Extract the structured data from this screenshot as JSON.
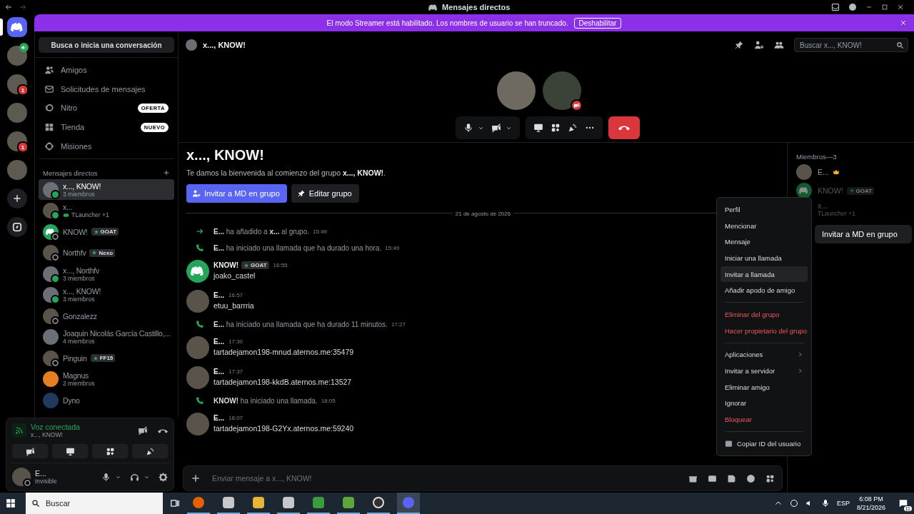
{
  "window": {
    "title": "Mensajes directos"
  },
  "banner": {
    "text": "El modo Streamer está habilitado. Los nombres de usuario se han truncado.",
    "button": "Deshabilitar"
  },
  "servers": [
    {
      "kind": "home",
      "selected": true
    },
    {
      "kind": "voice",
      "selected": false
    },
    {
      "kind": "photo",
      "badge": "1",
      "selected": false
    },
    {
      "kind": "photo",
      "selected": false
    },
    {
      "kind": "photo",
      "badge": "1",
      "selected": false
    },
    {
      "kind": "photo",
      "selected": false
    },
    {
      "kind": "add",
      "selected": false
    },
    {
      "kind": "discover",
      "selected": false
    }
  ],
  "sidebar": {
    "search": "Busca o inicia una conversación",
    "nav": [
      {
        "label": "Amigos"
      },
      {
        "label": "Solicitudes de mensajes"
      },
      {
        "label": "Nitro",
        "badge": "OFERTA"
      },
      {
        "label": "Tienda",
        "badge": "NUEVO"
      },
      {
        "label": "Misiones"
      }
    ],
    "dm_header": "Mensajes directos",
    "dms": [
      {
        "name": "x..., KNOW!",
        "subtitle": "3 miembros",
        "kind": "group",
        "online": true,
        "selected": true
      },
      {
        "name": "x...",
        "activity": "TLauncher +1",
        "kind": "user",
        "online": true,
        "selected": false
      },
      {
        "name": "KNOW!",
        "badge": "GOAT",
        "kind": "bot",
        "online": false,
        "selected": false
      },
      {
        "name": "Northfv",
        "badge": "Nexo",
        "kind": "user",
        "online": false,
        "selected": false
      },
      {
        "name": "x..., Northfv",
        "subtitle": "3 miembros",
        "kind": "group",
        "online": true,
        "selected": false
      },
      {
        "name": "x..., KNOW!",
        "subtitle": "3 miembros",
        "kind": "group",
        "online": true,
        "selected": false
      },
      {
        "name": "Gonzalezz",
        "kind": "user",
        "online": false,
        "selected": false
      },
      {
        "name": "Joaquin Nicolás García Castillo,...",
        "subtitle": "4 miembros",
        "kind": "group",
        "selected": false
      },
      {
        "name": "Pinguin",
        "badge": "FF15",
        "kind": "user",
        "online": false,
        "selected": false
      },
      {
        "name": "Magnus",
        "subtitle": "2 miembros",
        "kind": "orange_group",
        "selected": false
      },
      {
        "name": "Dyno",
        "kind": "app",
        "selected": false
      }
    ]
  },
  "voice_panel": {
    "status": "Voz conectada",
    "channel": "x..., KNOW!"
  },
  "user_panel": {
    "name": "E...",
    "status": "Invisible"
  },
  "chat": {
    "header": "x..., KNOW!",
    "search_placeholder": "Buscar x..., KNOW!",
    "call": [
      {
        "muted": false
      },
      {
        "muted": true
      }
    ],
    "title": "x..., KNOW!",
    "welcome": "Te damos la bienvenida al comienzo del grupo **x..., KNOW!**.",
    "buttons": [
      {
        "label": "Invitar a MD en grupo",
        "kind": "primary"
      },
      {
        "label": "Editar grupo",
        "kind": "secondary"
      }
    ],
    "date": "21 de agosto de 2026",
    "messages": [
      {
        "kind": "join",
        "text": "**E...** ha añadido a **x...** al grupo.",
        "time": "15:49"
      },
      {
        "kind": "call",
        "text": "**E...** ha iniciado una llamada que ha durado una hora.",
        "time": "15:49"
      },
      {
        "kind": "bot_message",
        "author": "KNOW!",
        "badge": "GOAT",
        "time": "16:55",
        "text": "joako_castel"
      },
      {
        "kind": "user_message",
        "author": "E...",
        "time": "16:57",
        "text": "etuu_barrria"
      },
      {
        "kind": "call",
        "text": "**E...** ha iniciado una llamada que ha durado 11 minutos.",
        "time": "17:27"
      },
      {
        "kind": "user_message",
        "author": "E...",
        "time": "17:30",
        "text": "tartadejamon198-mnud.aternos.me:35479"
      },
      {
        "kind": "user_message",
        "author": "E...",
        "time": "17:37",
        "text": "tartadejamon198-kkdB.aternos.me:13527"
      },
      {
        "kind": "call",
        "text": "**KNOW!** ha iniciado una llamada.",
        "time": "18:05"
      },
      {
        "kind": "user_message",
        "author": "E...",
        "time": "18:07",
        "text": "tartadejamon198-G2Yx.aternos.me:59240"
      }
    ],
    "composer_placeholder": "Enviar mensaje a x..., KNOW!"
  },
  "members": {
    "header": "Miembros—3",
    "list": [
      {
        "name": "E...",
        "owner": true,
        "kind": "user"
      },
      {
        "name": "KNOW!",
        "badge": "GOAT",
        "owner": false,
        "kind": "bot"
      },
      {
        "name": "x...",
        "activity": "TLauncher +1",
        "owner": false,
        "kind": "user"
      }
    ],
    "invite_button": "Invitar a MD en grupo"
  },
  "context_menu": {
    "groups": [
      [
        {
          "label": "Perfil",
          "kind": "normal",
          "submenu": false,
          "selected": false
        },
        {
          "label": "Mencionar",
          "kind": "normal",
          "submenu": false,
          "selected": false
        },
        {
          "label": "Mensaje",
          "kind": "normal",
          "submenu": false,
          "selected": false
        },
        {
          "label": "Iniciar una llamada",
          "kind": "normal",
          "submenu": false,
          "selected": false
        },
        {
          "label": "Invitar a llamada",
          "kind": "normal",
          "submenu": false,
          "selected": true
        },
        {
          "label": "Añadir apodo de amigo",
          "kind": "normal",
          "submenu": false,
          "selected": false
        }
      ],
      [
        {
          "label": "Eliminar del grupo",
          "kind": "danger",
          "submenu": false,
          "selected": false
        },
        {
          "label": "Hacer propietario del grupo",
          "kind": "danger",
          "submenu": false,
          "selected": false
        }
      ],
      [
        {
          "label": "Aplicaciones",
          "kind": "normal",
          "submenu": true,
          "selected": false
        },
        {
          "label": "Invitar a servidor",
          "kind": "normal",
          "submenu": true,
          "selected": false
        },
        {
          "label": "Eliminar amigo",
          "kind": "normal",
          "submenu": false,
          "selected": false
        },
        {
          "label": "Ignorar",
          "kind": "normal",
          "submenu": false,
          "selected": false
        },
        {
          "label": "Bloquear",
          "kind": "danger",
          "submenu": false,
          "selected": false
        }
      ],
      [
        {
          "label": "Copiar ID del usuario",
          "kind": "copy_id",
          "submenu": false,
          "selected": false
        }
      ]
    ]
  },
  "taskbar": {
    "search": "Buscar",
    "apps": [
      {
        "kind": "browser",
        "selected": false
      },
      {
        "kind": "tool",
        "selected": false
      },
      {
        "kind": "folder",
        "selected": false
      },
      {
        "kind": "tool",
        "selected": false
      },
      {
        "kind": "emulator",
        "selected": false
      },
      {
        "kind": "block",
        "selected": false
      },
      {
        "kind": "recorder",
        "selected": false
      },
      {
        "kind": "chat",
        "selected": true
      }
    ],
    "language": "ESP",
    "time": "6:08 PM",
    "date": "8/21/2026",
    "notifications": "11"
  }
}
